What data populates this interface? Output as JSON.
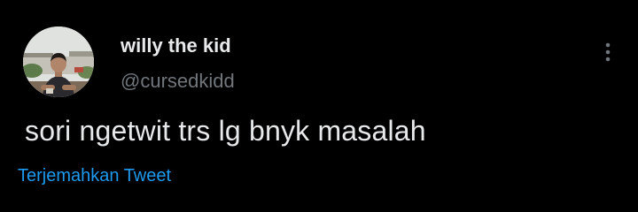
{
  "tweet": {
    "display_name": "willy the kid",
    "handle": "@cursedkidd",
    "text": "sori ngetwit trs lg bnyk masalah",
    "translate_label": "Terjemahkan Tweet"
  },
  "icons": {
    "more": "more-vertical-icon",
    "avatar": "profile-photo"
  },
  "colors": {
    "background": "#000000",
    "primary_text": "#e7e9ea",
    "secondary_text": "#71767b",
    "link": "#1d9bf0"
  }
}
